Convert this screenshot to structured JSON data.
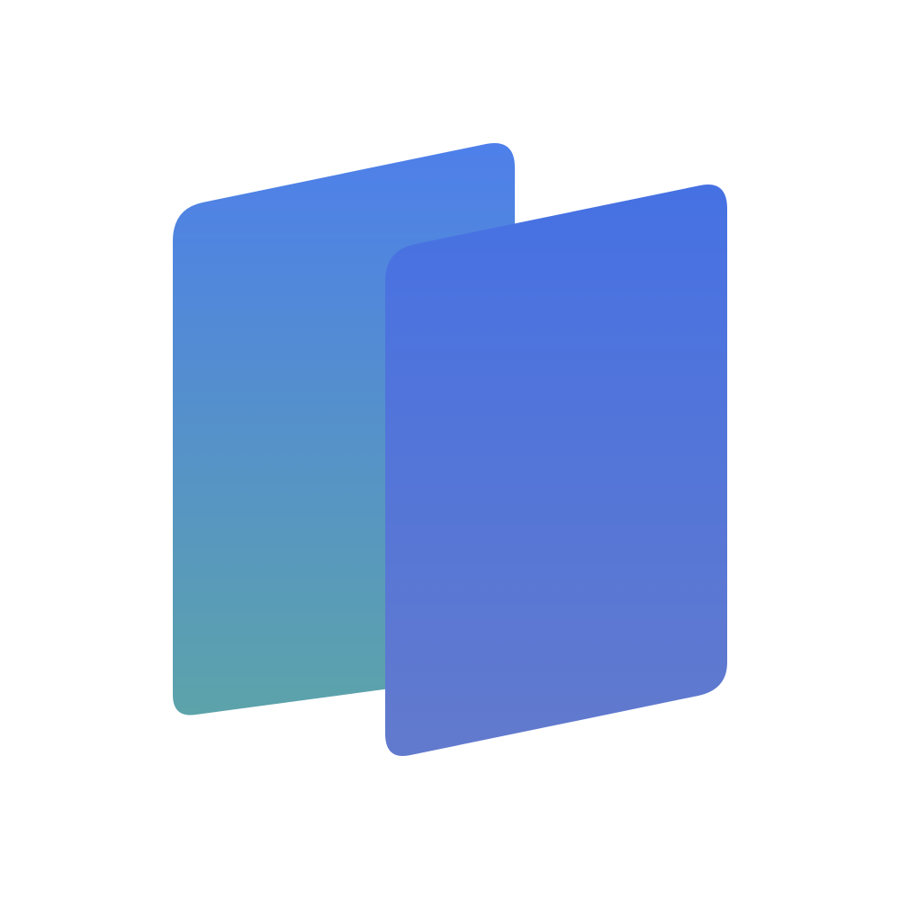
{
  "logo": {
    "icon": "two-overlapping-cards-logo",
    "back_card": {
      "gradient_top": "#4E7FEA",
      "gradient_bottom": "#5CA3AA"
    },
    "front_card": {
      "gradient_top": "#4671E3",
      "gradient_bottom": "#627ACD"
    },
    "background": "#FFFFFF"
  }
}
